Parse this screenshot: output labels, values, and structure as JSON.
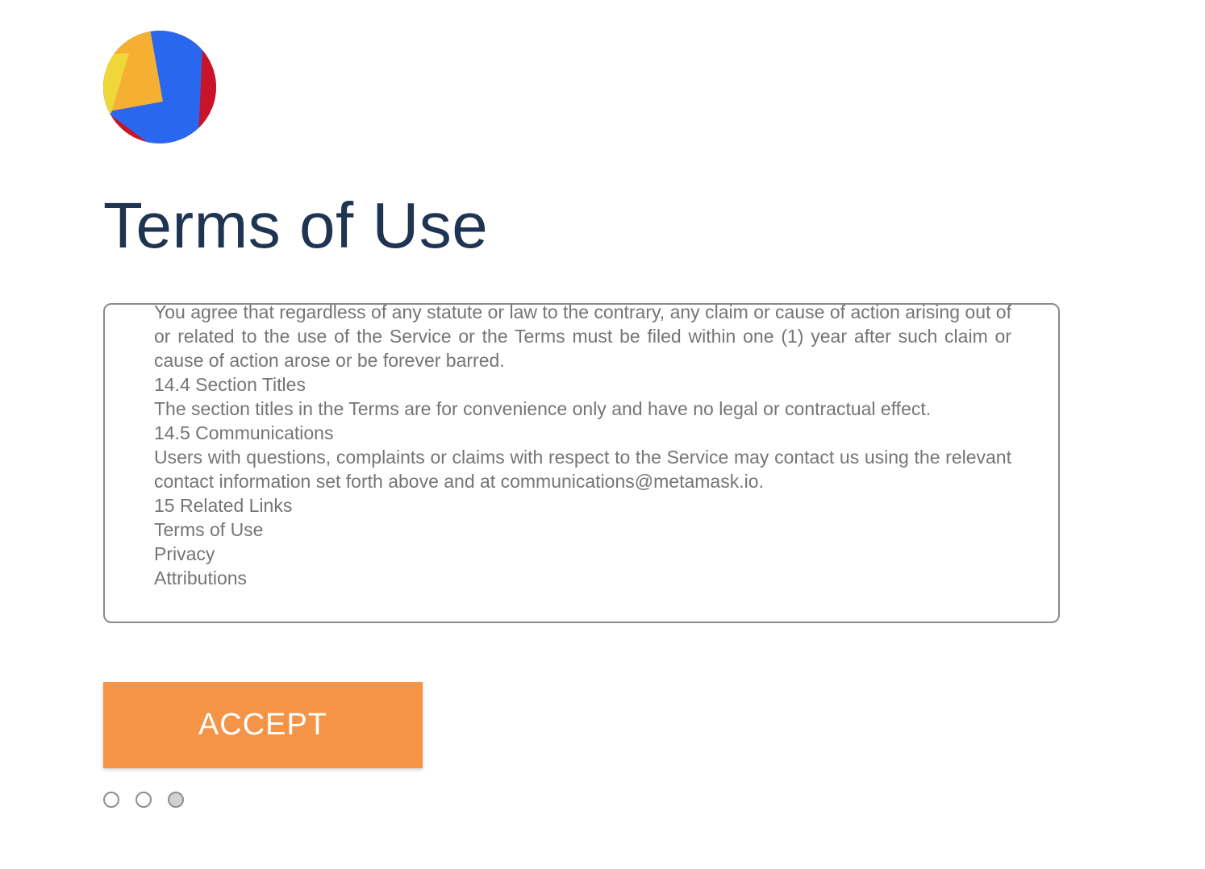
{
  "header": {
    "logo_icon": "metamask-fox-colored-circle-icon",
    "title": "Terms of Use"
  },
  "terms": {
    "paragraphs": [
      "You agree that regardless of any statute or law to the contrary, any claim or cause of action arising out of or related to the use of the Service or the Terms must be filed within one (1) year after such claim or cause of action arose or be forever barred.",
      "14.4 Section Titles",
      "The section titles in the Terms are for convenience only and have no legal or contractual effect.",
      "14.5 Communications",
      "Users with questions, complaints or claims with respect to the Service may contact us using the relevant contact information set forth above and at communications@metamask.io.",
      "15 Related Links",
      "Terms of Use",
      "Privacy",
      "Attributions"
    ]
  },
  "actions": {
    "accept_label": "ACCEPT"
  },
  "pagination": {
    "total": 3,
    "active_index": 2
  },
  "colors": {
    "title": "#1d3452",
    "body_text": "#757575",
    "accept_button": "#f59447",
    "box_border": "#8a8a8a"
  }
}
